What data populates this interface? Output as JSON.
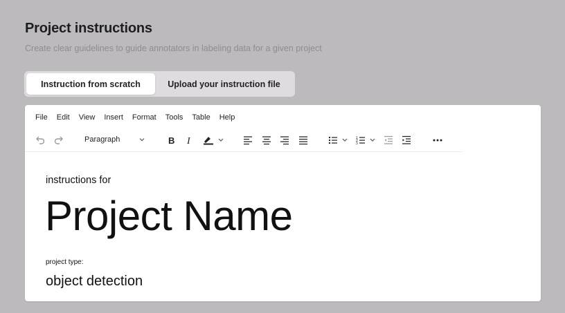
{
  "header": {
    "title": "Project instructions",
    "subtitle": "Create clear guidelines to guide annotators in labeling data for a given project"
  },
  "tabs": [
    {
      "label": "Instruction from scratch",
      "active": true
    },
    {
      "label": "Upload your instruction file",
      "active": false
    }
  ],
  "editor": {
    "menu": [
      "File",
      "Edit",
      "View",
      "Insert",
      "Format",
      "Tools",
      "Table",
      "Help"
    ],
    "toolbar": {
      "block_format": "Paragraph",
      "icons": [
        "undo-icon",
        "redo-icon",
        "bold-icon",
        "italic-icon",
        "highlight-icon",
        "align-left-icon",
        "align-center-icon",
        "align-right-icon",
        "justify-icon",
        "bullet-list-icon",
        "numbered-list-icon",
        "outdent-icon",
        "indent-icon",
        "more-icon"
      ]
    },
    "content": {
      "intro": "instructions for",
      "project_name": "Project Name",
      "type_label": "project type:",
      "type_value": "object detection"
    }
  },
  "colors": {
    "background": "#bcbabc",
    "tab_track": "#dedcdf",
    "active_tab": "#ffffff",
    "editor_bg": "#ffffff"
  }
}
